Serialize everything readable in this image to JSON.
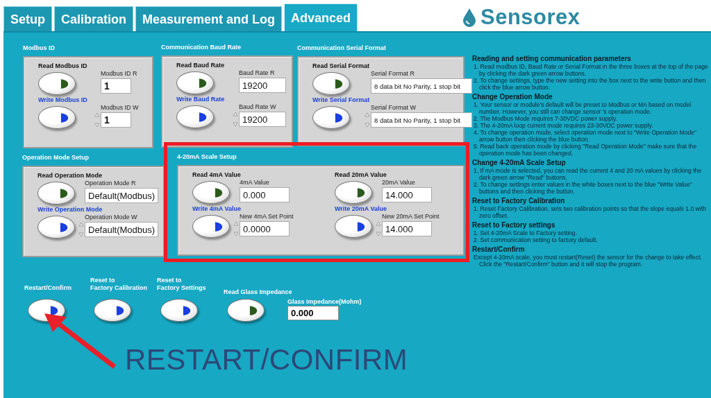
{
  "tabs": [
    {
      "label": "Setup",
      "selected": false
    },
    {
      "label": "Calibration",
      "selected": false
    },
    {
      "label": "Measurement and Log",
      "selected": false
    },
    {
      "label": "Advanced",
      "selected": true
    }
  ],
  "logo": {
    "text": "Sensorex"
  },
  "groups": [
    {
      "title": "Modbus ID",
      "highlighted": false,
      "columns": [
        [
          {
            "kind": "read",
            "button_label": "Read Modbus ID",
            "field_label": "Modbus  ID R",
            "value": "1"
          },
          {
            "kind": "write",
            "button_label": "Write Modbus ID",
            "field_label": "Modbus  ID W",
            "value": "1"
          }
        ]
      ]
    },
    {
      "title": "Communication Baud Rate",
      "highlighted": false,
      "columns": [
        [
          {
            "kind": "read",
            "button_label": "Read Baud Rate",
            "field_label": "Baud Rate R",
            "value": "19200"
          },
          {
            "kind": "write",
            "button_label": "Write Baud Rate",
            "field_label": "Baud Rate W",
            "value": "19200"
          }
        ]
      ]
    },
    {
      "title": "Communication Serial Format",
      "highlighted": false,
      "columns": [
        [
          {
            "kind": "read",
            "button_label": "Read Serial Format",
            "field_label": "Serial Format R",
            "value": "8 data bit No Parity, 1 stop bit"
          },
          {
            "kind": "write",
            "button_label": "Write Serial Format",
            "field_label": "Serial Format W",
            "value": "8 data bit No Parity, 1 stop bit"
          }
        ]
      ]
    },
    {
      "title": "Operation Mode Setup",
      "highlighted": false,
      "columns": [
        [
          {
            "kind": "read",
            "button_label": "Read Operation Mode",
            "field_label": "Operation Mode R",
            "value": "Default(Modbus)"
          },
          {
            "kind": "write",
            "button_label": "Write Operation Mode",
            "field_label": "Operation Mode W",
            "value": "Default(Modbus)"
          }
        ]
      ]
    },
    {
      "title": "4-20mA Scale Setup",
      "highlighted": true,
      "columns": [
        [
          {
            "kind": "read",
            "button_label": "Read 4mA Value",
            "field_label": "4mA Value",
            "value": "0.000"
          },
          {
            "kind": "write",
            "button_label": "Write 4mA Value",
            "field_label": "New 4mA Set Point",
            "value": "0.0000"
          }
        ],
        [
          {
            "kind": "read",
            "button_label": "Read 20mA Value",
            "field_label": "20mA Value",
            "value": "14.000"
          },
          {
            "kind": "write",
            "button_label": "Write 20mA Value",
            "field_label": "New 20mA Set Point",
            "value": "14.000"
          }
        ]
      ]
    }
  ],
  "bottom_buttons": [
    {
      "kind": "write",
      "label": "Restart/Confirm"
    },
    {
      "kind": "write",
      "label": "Reset to\nFactory Calibration"
    },
    {
      "kind": "write",
      "label": "Reset to\nFactory Settings"
    },
    {
      "kind": "read",
      "label": "Read Glass Impedance"
    }
  ],
  "glass_impedance": {
    "label": "Glass Impedance(Mohm)",
    "value": "0.000"
  },
  "instructions": [
    {
      "heading": "Reading and setting communication parameters",
      "items": [
        "1. Read modbus ID, Baud Rate or Serial Format in the three boxes at the top of the page by clicking the dark green arrow buttons.",
        "2. To change settings, type the new setting into the box next to the write button and then click the blue arrow button."
      ]
    },
    {
      "heading": "Change Operation Mode",
      "items": [
        "1. Your sensor or module's default will be preset to Modbus or MA based on model number.  However, you still can change sensor 's operation mode.",
        "2. The Modbus Mode requires 7-30VDC power supply.",
        "3. The 4-20mA loop current mode requires 23-30VDC power supply.",
        "4. To change operation mode, select operation mode next to \"Write Operation Mode\" arrow button then clicking the blue button.",
        "5. Read back operation mode by clicking \"Read Operation Mode\" make sure that the operation mode has been changed."
      ]
    },
    {
      "heading": "Change 4-20mA Scale Setup",
      "items": [
        "1. If mA mode is selected, you can read the current 4 and 20 mA values by clicking the dark green arrow \"Read\" buttons.",
        "2. To change settings enter values in the white boxes next to the blue \"Write Value\" buttons and then clicking the button."
      ]
    },
    {
      "heading": "Reset to Factory Calibration",
      "items": [
        "1.  Reset Factory Calibration, sets two calibration points so that the slope equals 1.0 with zero offset."
      ]
    },
    {
      "heading": "Reset to Factory settings",
      "items": [
        "1.  Set 4-20mA Scale to Factory setting.",
        "2.  Set communication setting to factory default."
      ]
    },
    {
      "heading": "Restart/Confirm",
      "items": [
        "Except 4-20mA scale, you must restart(Reset) the sensor for the change to take effect. Click the \"Restart/Confirm\" button and it will stop the program."
      ]
    }
  ],
  "annotation": {
    "text": "RESTART/CONFIRM"
  }
}
